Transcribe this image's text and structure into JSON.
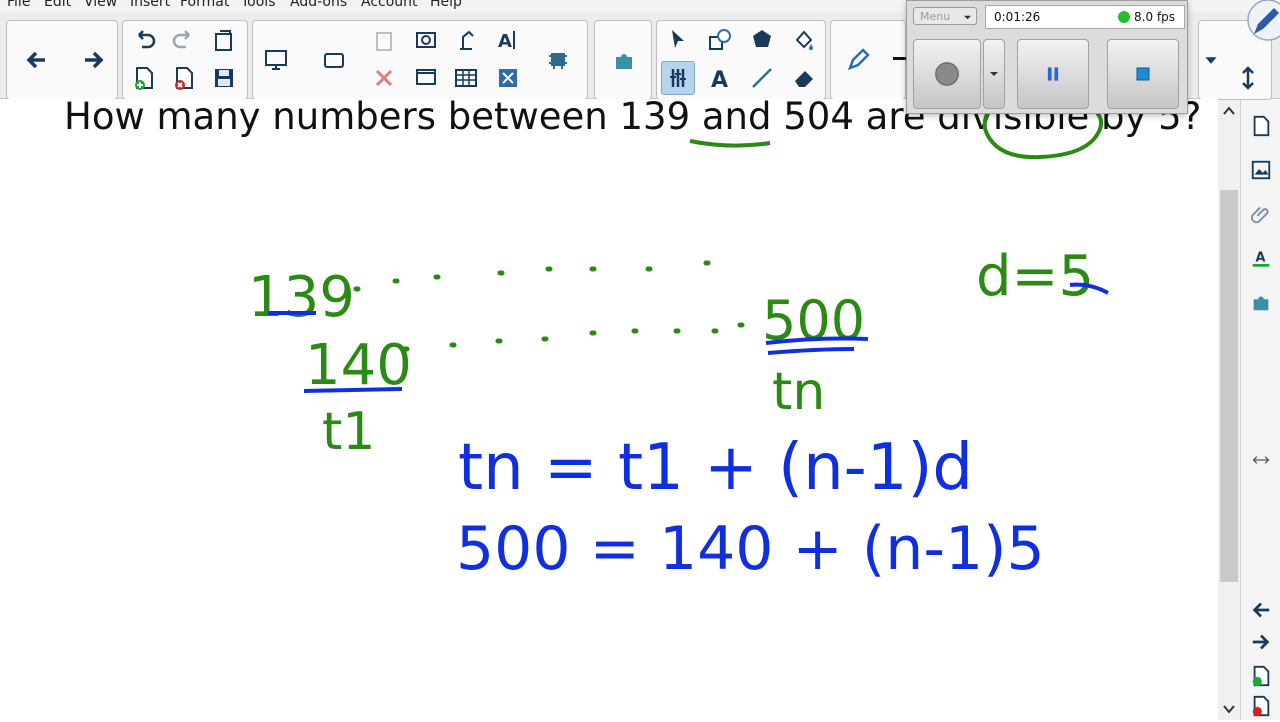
{
  "menu": {
    "file": "File",
    "edit": "Edit",
    "view": "View",
    "insert": "Insert",
    "format": "Format",
    "tools": "Tools",
    "addons": "Add-ons",
    "account": "Account",
    "help": "Help"
  },
  "recorder": {
    "menu_label": "Menu",
    "elapsed": "0:01:26",
    "fps": "8.0 fps",
    "status_color": "#21c02a"
  },
  "lesson": {
    "question": "How many numbers between 139 and 504 are divisible by 5?",
    "seq_first": "139",
    "seq_first_multiple": "140",
    "seq_last_multiple": "500",
    "label_t1": "t1",
    "label_tn": "tn",
    "common_difference": "d=5",
    "formula": "tn = t1 + (n-1)d",
    "substitution": "500 = 140 + (n-1)5"
  },
  "colors": {
    "green_ink": "#2a8a14",
    "blue_ink": "#1030e0",
    "toolbar_bg": "#ececec",
    "active_tool_bg": "#b9d3ee"
  },
  "toolbar_icons": [
    "back-arrow-icon",
    "forward-arrow-icon",
    "undo-icon",
    "redo-icon",
    "paste-page-icon",
    "add-page-icon",
    "delete-page-icon",
    "save-icon",
    "screen-shade-icon",
    "camera-icon",
    "clipboard-icon",
    "delete-x-icon",
    "screen-capture-icon",
    "show-screen-icon",
    "recognize-text-icon",
    "table-icon",
    "full-screen-icon",
    "gallery-icon",
    "addons-icon",
    "select-pointer-icon",
    "shapes-icon",
    "fill-icon",
    "magic-pen-icon",
    "text-icon",
    "line-icon",
    "eraser-icon",
    "pen-icon"
  ]
}
